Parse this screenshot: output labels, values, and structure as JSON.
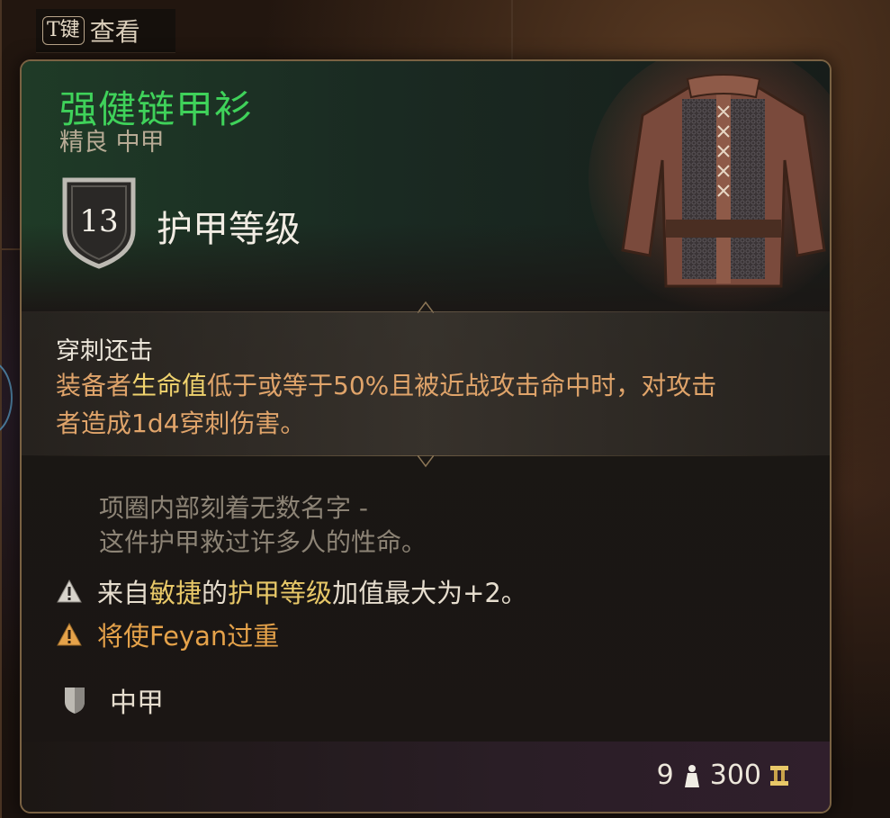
{
  "hint": {
    "key": "T键",
    "label": "查看"
  },
  "item": {
    "name": "强健链甲衫",
    "subtitle": "精良 中甲",
    "armor_class": {
      "value": "13",
      "label": "护甲等级"
    }
  },
  "passive": {
    "title": "穿刺还击",
    "desc_part1": "装备者",
    "desc_highlight": "生命值",
    "desc_part2": "低于或等于50%且被近战攻击命中时，对攻击者造成1d4穿刺伤害。"
  },
  "flavor": {
    "line1": "项圈内部刻着无数名字 -",
    "line2": "这件护甲救过许多人的性命。"
  },
  "warnings": [
    {
      "pre": "来自",
      "dex": "敏捷",
      "mid": "的",
      "ac": "护甲等级",
      "post": "加值最大为+2。"
    },
    {
      "text": "将使Feyan过重"
    }
  ],
  "armor_type": "中甲",
  "footer": {
    "weight": "9",
    "price": "300"
  },
  "icons": [
    "shield-icon",
    "warning-icon",
    "armor-type-icon",
    "weight-icon",
    "gold-icon",
    "chainmail-shirt-icon"
  ],
  "colors": {
    "name_green": "#3fd25a",
    "passive_orange": "#e0a46a",
    "highlight_yellow": "#f0d36e",
    "warn_orange": "#e5a24a",
    "border": "#7a6243"
  }
}
